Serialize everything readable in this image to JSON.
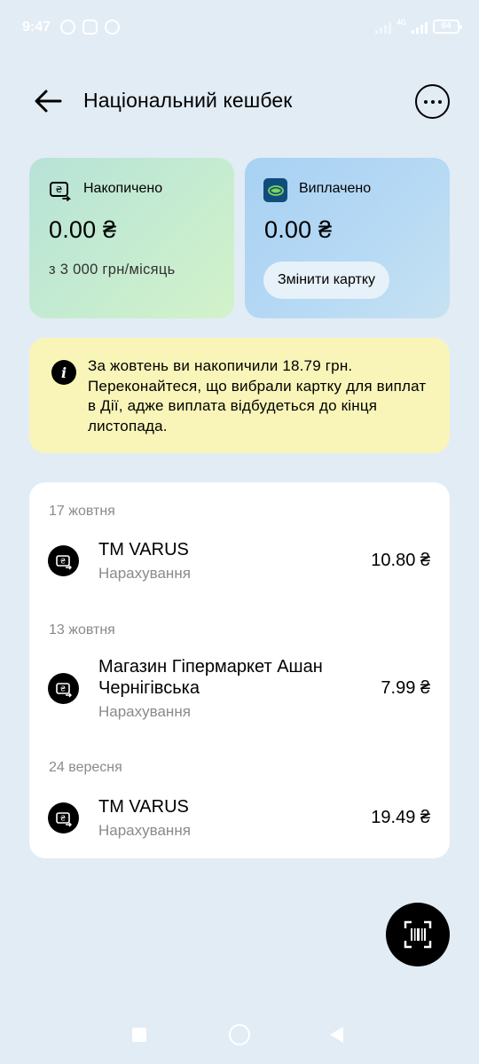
{
  "status_bar": {
    "time": "9:47",
    "network": "4G",
    "battery": "64"
  },
  "header": {
    "title": "Національний кешбек",
    "back_icon": "arrow-left-icon",
    "more_icon": "more-horizontal-icon"
  },
  "accumulated": {
    "label": "Накопичено",
    "amount": "0.00 ₴",
    "limit": "з 3 000 грн/місяць",
    "icon": "cashback-icon"
  },
  "paid_out": {
    "label": "Виплачено",
    "amount": "0.00 ₴",
    "button_label": "Змінити картку",
    "icon": "bank-card-icon"
  },
  "info_banner": {
    "icon": "info-icon",
    "text": "За жовтень ви накопичили 18.79 грн. Переконайтеся, що вибрали картку для виплат в Дії, адже виплата відбудеться до кінця листопада."
  },
  "transactions": [
    {
      "date": "17 жовтня",
      "name": "ТМ VARUS",
      "type": "Нарахування",
      "amount": "10.80 ₴"
    },
    {
      "date": "13 жовтня",
      "name": "Магазин Гіпермаркет Ашан Чернігівська",
      "type": "Нарахування",
      "amount": "7.99 ₴"
    },
    {
      "date": "24 вересня",
      "name": "ТМ VARUS",
      "type": "Нарахування",
      "amount": "19.49 ₴"
    }
  ],
  "colors": {
    "background": "#e2ecf5",
    "accumulated_card": "#c4ebd1",
    "paid_card": "#b6d9f4",
    "info_banner": "#f9f5b9",
    "bank_icon": "#0f4d7c"
  }
}
